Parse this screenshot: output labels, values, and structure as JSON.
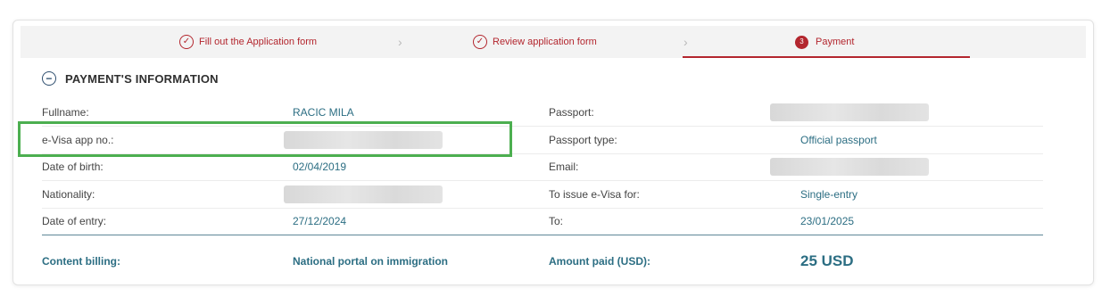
{
  "stepper": {
    "steps": [
      {
        "label": "Fill out the Application form",
        "icon": "check-circle-icon"
      },
      {
        "label": "Review application form",
        "icon": "check-circle-icon"
      },
      {
        "label": "Payment",
        "number": "3"
      }
    ],
    "accent_color": "#b3262e"
  },
  "section": {
    "title": "PAYMENT'S INFORMATION",
    "icon": "minus-circle-icon"
  },
  "rows": [
    {
      "l1": "Fullname:",
      "v1": "RACIC MILA",
      "l2": "Passport:",
      "v2": ""
    },
    {
      "l1": "e-Visa app no.:",
      "v1": "",
      "l2": "Passport type:",
      "v2": "Official passport"
    },
    {
      "l1": "Date of birth:",
      "v1": "02/04/2019",
      "l2": "Email:",
      "v2": ""
    },
    {
      "l1": "Nationality:",
      "v1": "",
      "l2": "To issue e-Visa for:",
      "v2": "Single-entry"
    },
    {
      "l1": "Date of entry:",
      "v1": "27/12/2024",
      "l2": "To:",
      "v2": "23/01/2025"
    }
  ],
  "billing": {
    "label": "Content billing:",
    "value": "National portal on immigration",
    "amount_label": "Amount paid (USD):",
    "amount": "25 USD"
  },
  "colors": {
    "value_text": "#2c6e83",
    "highlight": "#4caf50"
  }
}
